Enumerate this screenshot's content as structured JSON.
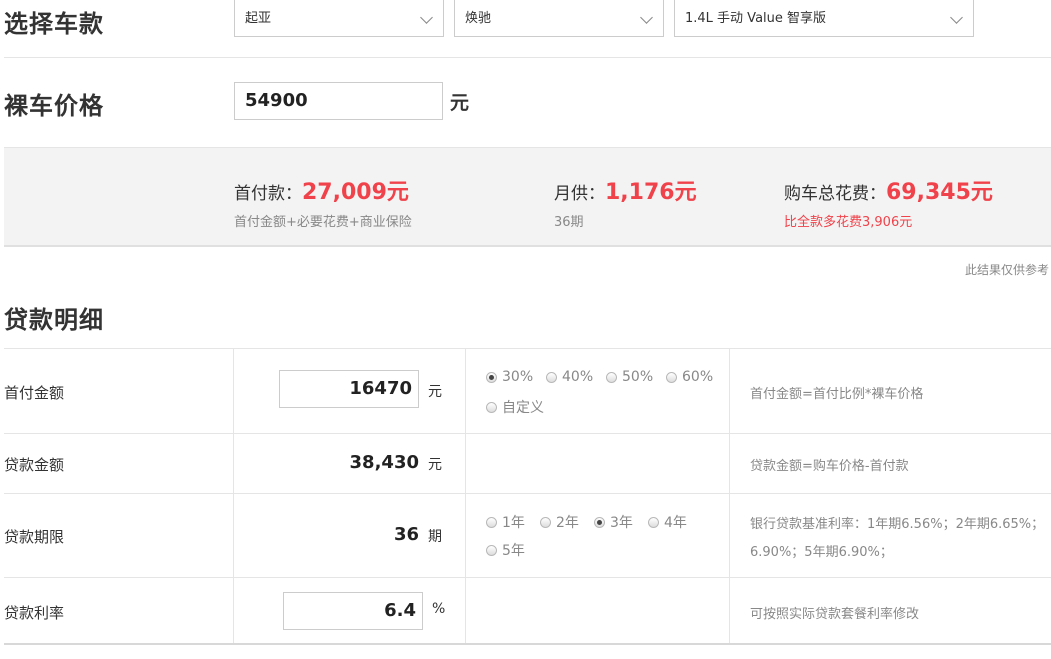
{
  "select_car": {
    "title": "选择车款",
    "brand": "起亚",
    "series": "焕驰",
    "model": "1.4L 手动 Value 智享版"
  },
  "bare_price": {
    "title": "裸车价格",
    "value": "54900",
    "unit": "元"
  },
  "summary": {
    "down_payment_label": "首付款：",
    "down_payment_value": "27,009元",
    "down_payment_sub": "首付金额+必要花费+商业保险",
    "monthly_label": "月供：",
    "monthly_value": "1,176元",
    "monthly_sub": "36期",
    "total_label": "购车总花费：",
    "total_value": "69,345元",
    "total_sub": "比全款多花费3,906元"
  },
  "note": "此结果仅供参考",
  "loan_detail": {
    "title": "贷款明细",
    "rows": [
      {
        "label": "首付金额",
        "value": "16470",
        "unit": "元",
        "options": [
          "30%",
          "40%",
          "50%",
          "60%",
          "自定义"
        ],
        "selected": "30%",
        "formula": "首付金额=首付比例*裸车价格"
      },
      {
        "label": "贷款金额",
        "value": "38,430",
        "unit": "元",
        "formula": "贷款金额=购车价格-首付款"
      },
      {
        "label": "贷款期限",
        "value": "36",
        "unit": "期",
        "options": [
          "1年",
          "2年",
          "3年",
          "4年",
          "5年"
        ],
        "selected": "3年",
        "formula_line1": "银行贷款基准利率：1年期6.56%；2年期6.65%；",
        "formula_line2": "6.90%；5年期6.90%；"
      },
      {
        "label": "贷款利率",
        "value": "6.4",
        "unit": "%",
        "formula": "可按照实际贷款套餐利率修改"
      }
    ]
  }
}
